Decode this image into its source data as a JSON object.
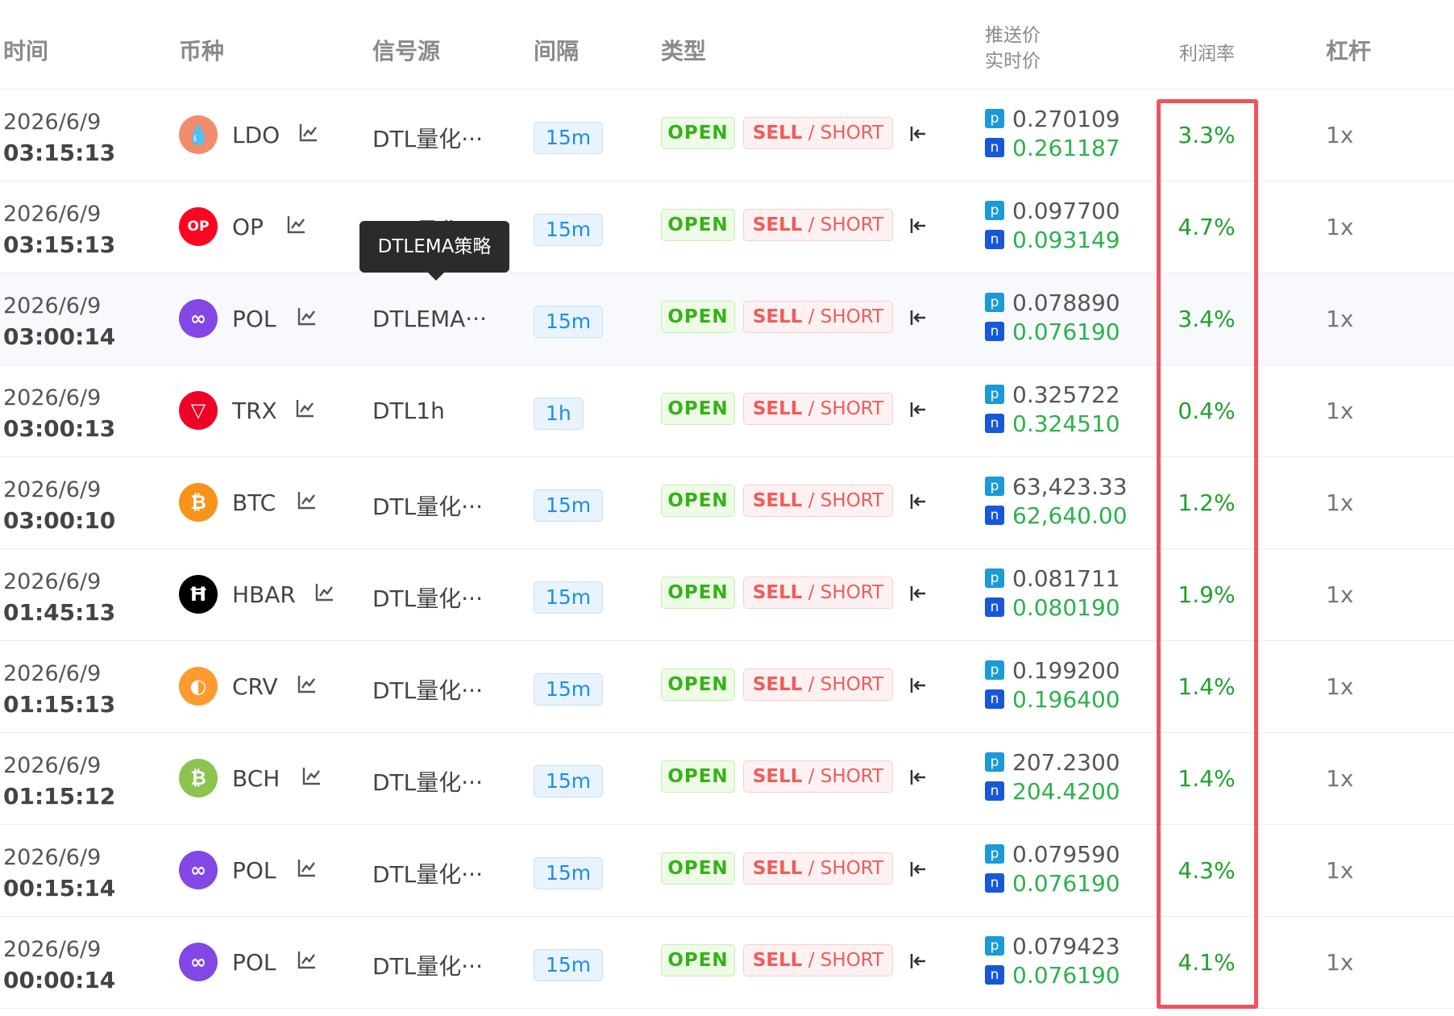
{
  "headers": {
    "time": "时间",
    "coin": "币种",
    "source": "信号源",
    "interval": "间隔",
    "type": "类型",
    "push_price": "推送价",
    "live_price": "实时价",
    "profit": "利润率",
    "leverage": "杠杆"
  },
  "tooltip": "DTLEMA策略",
  "labels": {
    "open": "OPEN",
    "sell": "SELL",
    "slash": " / ",
    "short": "SHORT",
    "p": "p",
    "n": "n"
  },
  "colors": {
    "open_green": "#34b217",
    "sell_red": "#ef5c5c",
    "profit_green": "#1fa12b",
    "live_green": "#2bb24a",
    "interval_blue": "#1f8ee5",
    "highlight_red": "#f0525e"
  },
  "rows": [
    {
      "date": "2026/6/9",
      "time": "03:15:13",
      "coin": "LDO",
      "icon": "ldo-icon",
      "icon_color": "#f28c6c",
      "source": "DTL量化···",
      "interval": "15m",
      "push": "0.270109",
      "live": "0.261187",
      "profit": "3.3%",
      "lev": "1x"
    },
    {
      "date": "2026/6/9",
      "time": "03:15:13",
      "coin": "OP",
      "icon": "op-icon",
      "icon_color": "#ff0420",
      "source": "DTL量化···",
      "interval": "15m",
      "push": "0.097700",
      "live": "0.093149",
      "profit": "4.7%",
      "lev": "1x"
    },
    {
      "date": "2026/6/9",
      "time": "03:00:14",
      "coin": "POL",
      "icon": "pol-icon",
      "icon_color": "#8247e5",
      "source": "DTLEMA···",
      "interval": "15m",
      "push": "0.078890",
      "live": "0.076190",
      "profit": "3.4%",
      "lev": "1x"
    },
    {
      "date": "2026/6/9",
      "time": "03:00:13",
      "coin": "TRX",
      "icon": "trx-icon",
      "icon_color": "#ef0027",
      "source": "DTL1h",
      "interval": "1h",
      "push": "0.325722",
      "live": "0.324510",
      "profit": "0.4%",
      "lev": "1x"
    },
    {
      "date": "2026/6/9",
      "time": "03:00:10",
      "coin": "BTC",
      "icon": "btc-icon",
      "icon_color": "#f7931a",
      "source": "DTL量化···",
      "interval": "15m",
      "push": "63,423.33",
      "live": "62,640.00",
      "profit": "1.2%",
      "lev": "1x"
    },
    {
      "date": "2026/6/9",
      "time": "01:45:13",
      "coin": "HBAR",
      "icon": "hbar-icon",
      "icon_color": "#000000",
      "source": "DTL量化···",
      "interval": "15m",
      "push": "0.081711",
      "live": "0.080190",
      "profit": "1.9%",
      "lev": "1x"
    },
    {
      "date": "2026/6/9",
      "time": "01:15:13",
      "coin": "CRV",
      "icon": "crv-icon",
      "icon_color": "#ff9a2e",
      "source": "DTL量化···",
      "interval": "15m",
      "push": "0.199200",
      "live": "0.196400",
      "profit": "1.4%",
      "lev": "1x"
    },
    {
      "date": "2026/6/9",
      "time": "01:15:12",
      "coin": "BCH",
      "icon": "bch-icon",
      "icon_color": "#8dc351",
      "source": "DTL量化···",
      "interval": "15m",
      "push": "207.2300",
      "live": "204.4200",
      "profit": "1.4%",
      "lev": "1x"
    },
    {
      "date": "2026/6/9",
      "time": "00:15:14",
      "coin": "POL",
      "icon": "pol-icon",
      "icon_color": "#8247e5",
      "source": "DTL量化···",
      "interval": "15m",
      "push": "0.079590",
      "live": "0.076190",
      "profit": "4.3%",
      "lev": "1x"
    },
    {
      "date": "2026/6/9",
      "time": "00:00:14",
      "coin": "POL",
      "icon": "pol-icon",
      "icon_color": "#8247e5",
      "source": "DTL量化···",
      "interval": "15m",
      "push": "0.079423",
      "live": "0.076190",
      "profit": "4.1%",
      "lev": "1x"
    }
  ]
}
